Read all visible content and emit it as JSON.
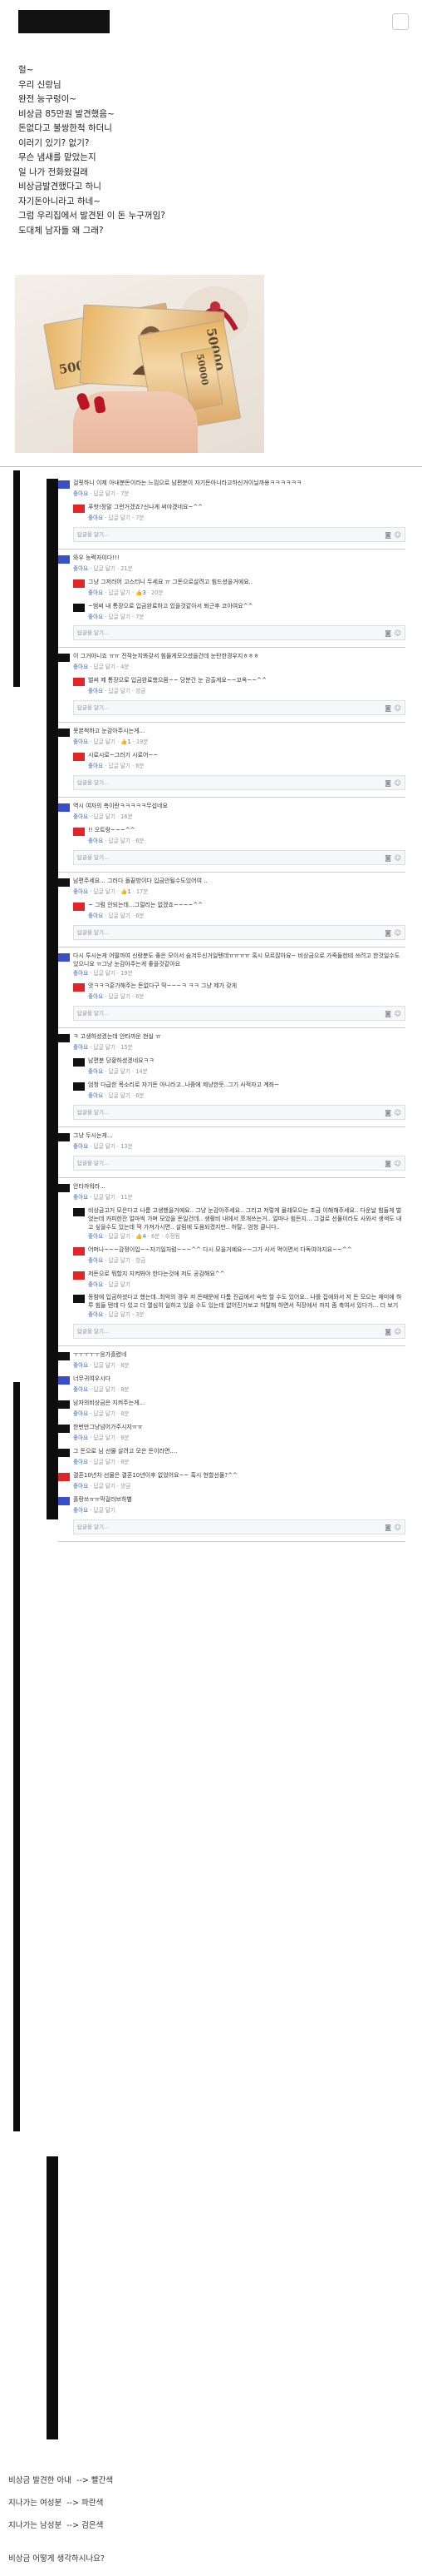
{
  "post": {
    "lines": [
      "헐~",
      "우리 신랑님",
      "완전 능구렁이~",
      "비상금 85만원 발견했음~",
      "돈없다고 불쌍한척 하더니",
      "이러기 있기? 없기?",
      "무슨 냄새를 맡았는지",
      "일 나가 전화왔길래",
      "비상금발견했다고 하니",
      "자기돈아니라고 하네~",
      "그럼 우리집에서 발견된 이 돈 누구꺼임?",
      "도대체 남자들 왜 그래?"
    ],
    "bill_numbers": [
      "50000",
      "50000",
      "50000"
    ]
  },
  "ui": {
    "like": "좋아요",
    "reply": "답글 달기",
    "reply_placeholder": "답글을 달기...",
    "camera_icon": "◙",
    "smile_icon": "☺",
    "dot": "·"
  },
  "threads": [
    {
      "comments": [
        {
          "avatar": "blue",
          "indent": false,
          "text": "걸핏하니 이제 아내분돈이라는 느낌으로 남편분이 자기돈아니라고하신거이닐까용ㅋㅋㅋㅋㅋㅋ",
          "likes": "",
          "time": "7분"
        },
        {
          "avatar": "red",
          "indent": true,
          "text": "푸핫!정말 그런거겠죠?신나게 써야겠네요~^^",
          "likes": "",
          "time": "7분"
        }
      ]
    },
    {
      "comments": [
        {
          "avatar": "blue",
          "indent": false,
          "text": "와우 능력자이다!!!",
          "likes": "",
          "time": "21분"
        },
        {
          "avatar": "red",
          "indent": true,
          "text": "그냥 그저러어 고스터니 두세요 ㅠ 그돈으로살려고 힘드셨을거에요..",
          "likes": "3",
          "time": "20분"
        },
        {
          "avatar": "black",
          "indent": true,
          "text": "~범써 내 통장으로 입금완료하고 있을것같아서 퇴근후 코아여요^^",
          "likes": "",
          "time": "7분"
        }
      ]
    },
    {
      "comments": [
        {
          "avatar": "black",
          "indent": false,
          "text": "이 그거아니죠 ㅠㅠ 진작눈치봐갖서 힘들게모으셨을건데 눈탄한경우지ㅎㅎㅎ",
          "likes": "",
          "time": "4분"
        },
        {
          "avatar": "red",
          "indent": true,
          "text": "벌써 제 통장으로 입금완료했으뭄~~ 당분간 눈 감출게요~~꼬옥~~^^",
          "likes": "",
          "time": "방금"
        }
      ]
    },
    {
      "comments": [
        {
          "avatar": "black",
          "indent": false,
          "text": "못본척하고 눈감아주시는게...",
          "likes": "1",
          "time": "19분"
        },
        {
          "avatar": "red",
          "indent": true,
          "text": "시로시로~그러기 시로어~~",
          "likes": "",
          "time": "6분"
        }
      ]
    },
    {
      "comments": [
        {
          "avatar": "blue",
          "indent": false,
          "text": "역시 여자의 촉이란ㅋㅋㅋㅋㅋ무섭네요",
          "likes": "",
          "time": "16분"
        },
        {
          "avatar": "red",
          "indent": true,
          "text": "!! 오트랑~~~^^",
          "likes": "",
          "time": "6분"
        }
      ]
    },
    {
      "comments": [
        {
          "avatar": "black",
          "indent": false,
          "text": "남편주세요... 그러다 돌끝방이다 입금안될수도있어여 ..",
          "likes": "1",
          "time": "17분"
        },
        {
          "avatar": "red",
          "indent": true,
          "text": "~ 그럼 안되는데...그럴리는 없겠죠~~~~^^",
          "likes": "",
          "time": "6분"
        }
      ]
    },
    {
      "comments": [
        {
          "avatar": "blue",
          "indent": false,
          "text": "다시 투시는게 어떨까여 신랑분도 좋은 모이서 숨겨두신거일텐데ㅠㅠㅠㅠ 혹시 모르잖아요~ 비상금으로 가족들한테 쓰려고 한것일수도 있으니요 ㅠ그냥 눈감아주는게 좋을것같아요",
          "likes": "",
          "time": "19분"
        },
        {
          "avatar": "red",
          "indent": true,
          "text": "앗ㅋㅋㅋ훈가해주는 돈없다구 딱~~~ㅋ ㅋㅋ 그냥 제가 갖게",
          "likes": "",
          "time": "6분"
        }
      ]
    },
    {
      "comments": [
        {
          "avatar": "black",
          "indent": false,
          "text": "ㅋ 고생하셨겠는데 안타까운 현실 ㅠ",
          "likes": "",
          "time": "15분"
        },
        {
          "avatar": "black",
          "indent": true,
          "text": "남편분 당황하셨겠네요ㅋㅋ",
          "likes": "",
          "time": "14분"
        },
        {
          "avatar": "black",
          "indent": true,
          "text": "엄청 다급한 목소리로 자기돈 아니라고..나중에 제냥한듯..그기 사적자고 계좌~",
          "likes": "",
          "time": "6분"
        }
      ]
    },
    {
      "comments": [
        {
          "avatar": "black",
          "indent": false,
          "text": "그냥 두시는게...",
          "likes": "",
          "time": "13분"
        }
      ]
    },
    {
      "comments": [
        {
          "avatar": "black",
          "indent": false,
          "text": "안타까워라...",
          "likes": "",
          "time": "11분"
        },
        {
          "avatar": "black",
          "indent": true,
          "text": "비상금고거 모은다고 나름 고생했을거에요.. 그냥 눈감아주세요.. 그리고 저렇게 몰래모으는 조금 이해해주세요.. 다운날 힘들게 벌었는데 카피한잔 얼마씩 가며 모았을 돈일건데.. 생활비 내에서 쪼개쓰는거.. 얼마나 힘든지... 그걸로 선물이라도 사와서 생색도 내고 싶을수도 있는데 딱 가져가시면.. 살림에 도움되겠지만.. 허탈.. 엄청 클니다..",
          "likes": "4",
          "time": "6분 · 수정됨"
        },
        {
          "avatar": "red",
          "indent": true,
          "text": "어머나~~~감정이입~~자기일처럼~~~^^ 다시 모을거예요~~그가 사서 먹이면서 다독여야지요~~^^",
          "likes": "",
          "time": "방금"
        },
        {
          "avatar": "red",
          "indent": true,
          "text": "저돈으로 뭐할지 지켜봐야 한다는것에 저도 공감해요^^",
          "likes": "",
          "time": ""
        },
        {
          "avatar": "black",
          "indent": true,
          "text": "동참에 입금하셨다고 했는데..최악의 경우 저 돈때문에 다툼 진급에서 숙학 할 수도 있어요.. 나를 집에와서 저 돈 모으는 재미에 하루 힘들 텐데 다 있고 더 열심히 일하고 있을 수도 있는데 없어진거보고 허탈해 하면서 직장에서 까지 좀 축여서 있다가... 더 보기",
          "likes": "",
          "time": "3분"
        }
      ]
    },
    {
      "comments": [
        {
          "avatar": "black",
          "indent": false,
          "text": "ㅜㅜㅜㅜㅜ응가흘렸네",
          "likes": "",
          "time": "8분"
        },
        {
          "avatar": "blue",
          "indent": false,
          "text": "너무귀여우시다",
          "likes": "",
          "time": "8분"
        },
        {
          "avatar": "black",
          "indent": false,
          "text": "남자의비상금은 지켜주는게...",
          "likes": "",
          "time": "8분"
        },
        {
          "avatar": "black",
          "indent": false,
          "text": "한번만그냥넘어가주시지ㅠㅠ",
          "likes": "",
          "time": "8분"
        },
        {
          "avatar": "black",
          "indent": false,
          "text": "그 돈으로 님 선물 살려고 모은 돈이라면....",
          "likes": "",
          "time": "8분"
        },
        {
          "avatar": "red",
          "indent": false,
          "text": "결혼10년차 선물은 결혼10년이후 없었어요~~ 혹시 현할선물?^^",
          "likes": "",
          "time": "방금"
        },
        {
          "avatar": "blue",
          "indent": false,
          "text": "홀랑쓰ㅠㅠ막걸러브하별",
          "likes": "",
          "time": ""
        }
      ]
    }
  ],
  "legend": [
    {
      "label": "비상금 발견한 아내",
      "arrow": "-->",
      "color": "빨간색"
    },
    {
      "label": "지나가는 여성분",
      "arrow": "-->",
      "color": "파란색"
    },
    {
      "label": "지나가는 남성분",
      "arrow": "-->",
      "color": "검은색"
    }
  ],
  "question": "비상금 어떻게 생각하시나요?"
}
